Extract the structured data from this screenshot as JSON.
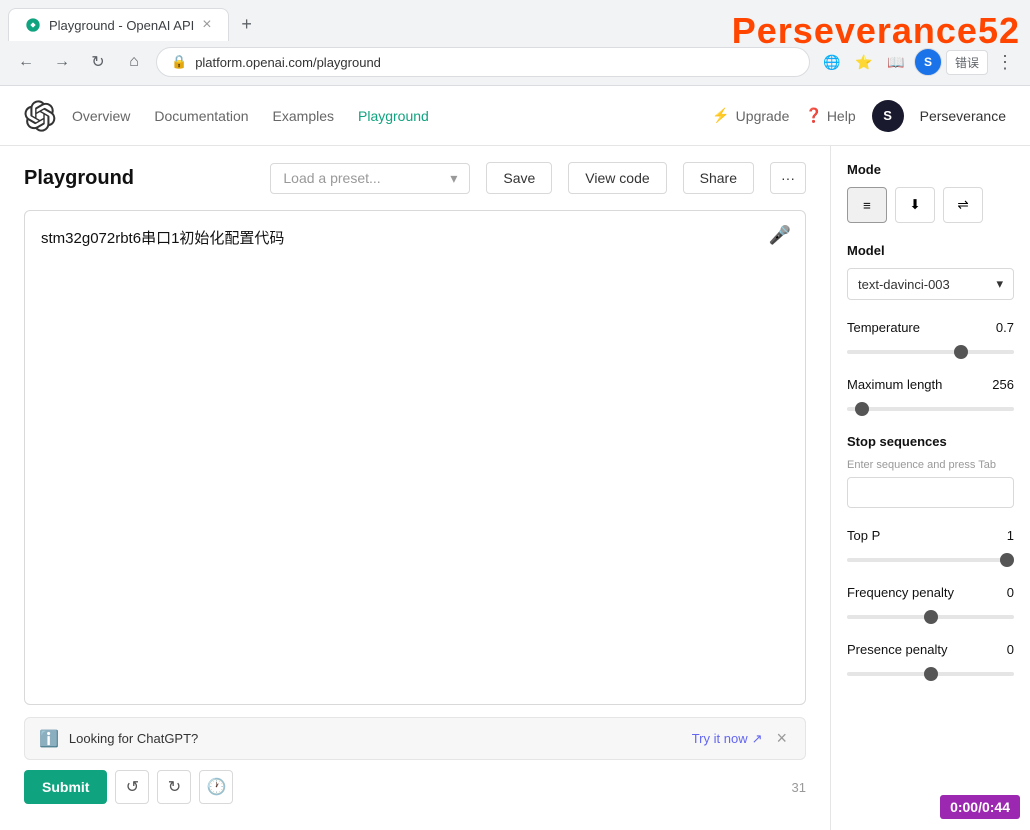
{
  "watermark": {
    "text": "Perseverance52"
  },
  "browser": {
    "tab_title": "Playground - OpenAI API",
    "address": "platform.openai.com/playground",
    "new_tab_icon": "+",
    "back_icon": "←",
    "forward_icon": "→",
    "reload_icon": "↻",
    "home_icon": "⌂",
    "lock_icon": "🔒",
    "translate_label": "错误",
    "profile_initial": "S"
  },
  "app_header": {
    "nav_items": [
      {
        "label": "Overview",
        "active": false
      },
      {
        "label": "Documentation",
        "active": false
      },
      {
        "label": "Examples",
        "active": false
      },
      {
        "label": "Playground",
        "active": true
      }
    ],
    "upgrade_label": "Upgrade",
    "help_label": "Help",
    "user_initial": "S",
    "user_name": "Perseverance"
  },
  "playground": {
    "title": "Playground",
    "preset_placeholder": "Load a preset...",
    "save_label": "Save",
    "view_code_label": "View code",
    "share_label": "Share",
    "more_label": "···",
    "prompt_text": "stm32g072rbt6串口1初始化配置代码",
    "mic_icon": "🎤",
    "banner": {
      "text": "Looking for ChatGPT?",
      "try_label": "Try it now",
      "try_icon": "↗",
      "close_icon": "×"
    },
    "submit_label": "Submit",
    "undo_icon": "↺",
    "redo_icon": "↻",
    "history_icon": "🕐",
    "char_count": "31"
  },
  "right_panel": {
    "mode_label": "Mode",
    "mode_buttons": [
      {
        "icon": "≡",
        "active": true
      },
      {
        "icon": "⬇",
        "active": false
      },
      {
        "icon": "≡≡",
        "active": false
      }
    ],
    "model_label": "Model",
    "model_value": "text-davinci-003",
    "temperature_label": "Temperature",
    "temperature_value": "0.7",
    "temperature_pct": 70,
    "max_length_label": "Maximum length",
    "max_length_value": "256",
    "max_length_pct": 5,
    "stop_sequences_label": "Stop sequences",
    "stop_sequences_hint": "Enter sequence and press Tab",
    "stop_seq_value": "",
    "top_p_label": "Top P",
    "top_p_value": "1",
    "top_p_pct": 100,
    "frequency_penalty_label": "Frequency penalty",
    "frequency_penalty_value": "0",
    "frequency_penalty_pct": 50,
    "presence_penalty_label": "Presence penalty",
    "presence_penalty_value": "0",
    "presence_penalty_pct": 50
  },
  "timer": {
    "text": "0:00/0:44"
  }
}
